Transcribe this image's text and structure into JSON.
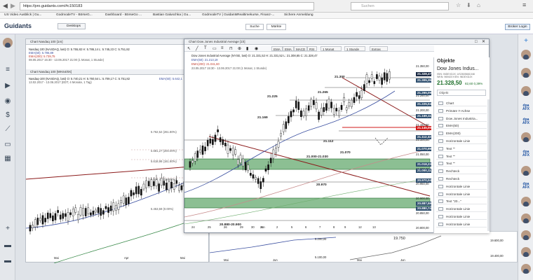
{
  "browser": {
    "url": "https://pro.guidants.com/#c150183",
    "search_placeholder": "Suchen"
  },
  "bookmarks": [
    "US Video Ausblick | Gu...",
    "GodmodeTV - BörseG...",
    "Dashboard - BörseGo ...",
    "Bastian Galuschka | Gu...",
    "GodmodeTV | Guidants",
    "Realtimekurse, Finanz-...",
    "Sichere Anmeldung"
  ],
  "app": {
    "logo": "Guidants",
    "desktop_tab": "Desktops",
    "search_button": "Suche",
    "markets_button": "Märkte",
    "login_button": "Broker Login"
  },
  "nasdaq_chart": {
    "title": "Chart Nasdaq 100 [1m]",
    "legend_top": "Nasdaq 100 (NASDAQ, last)  O: 5.755,82  H: 5.786,14  L: 5.745,23  C: 5.751,82",
    "legend_ema50": "EMA(50): 5.785,89",
    "legend_ema200": "EMA(200): 5.739,75",
    "legend_range": "08.05.2017 15:30 - 13.06.2017 21:00  (1 Monat, 1 Stunde)",
    "sub_title": "Chart Nasdaq 100 [WK64/8X]",
    "sub_legend": "Nasdaq-100 (NASDAQ, last)  O: 5.740,21  H: 5.760,54  L: 5.709,17  C: 5.751,82",
    "sub_ema": "EMA(50): 5.642,1",
    "sub_range": "13.02.2017 - 13.06.2017  (EDT, 4 Monate, 1 Tag)",
    "fib_labels": [
      "5.762,52 (261.80%)",
      "5.681,27 (200.00%)",
      "5.618,98 (161.80%)",
      "5.517,43 (100.00%)",
      "5.453,59 (0.00%)"
    ],
    "months": [
      "Mai",
      "Apr",
      "Mai",
      "Jun"
    ]
  },
  "dow_chart": {
    "title": "Chart Dow Jones Industrial Average [1h]",
    "toolbar": [
      "EMA",
      "EMA",
      "MACD",
      "RSI",
      "1 Monat",
      "1 Stunde",
      "Extras"
    ],
    "legend_top": "Dow Jones Industrial Average (NYSE, last)  O: 21.331,52  H: 21.331,52  L: 21.308,65  C: 21.328,47",
    "legend_ema50": "EMA(50): 21.213,19",
    "legend_ema200": "EMA(200): 21.041,60",
    "legend_range": "23.05.2017 15:30 - 13.06.2017 21:00  (1 Monat, 1 Stunde)",
    "annotations": [
      "21.300",
      "21.265",
      "21.225",
      "21.169",
      "21.112",
      "21.070",
      "21.000-21.030",
      "20.970",
      "20.880-20.900"
    ],
    "price_axis": [
      "21.350,00",
      "21.300,00",
      "21.250,00",
      "21.200,00",
      "21.150,00",
      "21.100,00",
      "21.050,00",
      "21.000,00",
      "20.950,00",
      "20.900,00",
      "20.850,00",
      "20.800,00"
    ],
    "price_tags": [
      {
        "label": "21.328,47",
        "color": "#1b2a44"
      },
      {
        "label": "21.305,35",
        "color": "#2f4f6f"
      },
      {
        "label": "21.265,09",
        "color": "#2f4f6f"
      },
      {
        "label": "21.225,04",
        "color": "#2f4f6f"
      },
      {
        "label": "21.169,11",
        "color": "#2f4f6f"
      },
      {
        "label": "21.145,00",
        "color": "#d01818"
      },
      {
        "label": "21.112,32",
        "color": "#2f4f6f"
      },
      {
        "label": "21.070,99",
        "color": "#2f4f6f"
      },
      {
        "label": "21.018,23",
        "color": "#2f4f6f"
      },
      {
        "label": "21.000,11",
        "color": "#2f4f6f"
      },
      {
        "label": "20.970,04",
        "color": "#2f4f6f"
      },
      {
        "label": "20.887,59",
        "color": "#2f4f6f"
      },
      {
        "label": "20.880,74",
        "color": "#2f4f6f"
      }
    ],
    "x_axis": [
      "24",
      "25",
      "26",
      "29",
      "30",
      "31",
      "Jun",
      "2",
      "5",
      "6",
      "7",
      "8",
      "9",
      "12",
      "13"
    ]
  },
  "bottom_area": {
    "months": [
      "Mai",
      "Jun",
      "Mai",
      "Jun"
    ],
    "values": [
      "5.200,00",
      "5.100,00",
      "19.750",
      "19.600,00",
      "19.400,00"
    ]
  },
  "objects_panel": {
    "header": "Objekte",
    "instrument": "Dow Jones Indus...",
    "isin_line": "ISIN: INDEXDJX: US2605661048",
    "wkn_line": "WKN: 969420  KEN: INDEXDJX",
    "price": "21.328,50",
    "change": "82,60  0,39%",
    "filter_label": "Objekt",
    "items": [
      "Chart",
      "Primäre Y-Achse",
      "Dow Jones Industria...",
      "EMA(50)",
      "EMA(200)",
      "Horizontale Linie",
      "Text \"\"",
      "Text \"\"",
      "Text \"\"",
      "Rechteck",
      "Rechteck",
      "Horizontale Linie",
      "Horizontale Linie",
      "Text \"20...\"",
      "Horizontale Linie",
      "Horizontale Linie",
      "Horizontale Linie"
    ]
  },
  "colors": {
    "up_candle": "#ffffff",
    "down_candle": "#111111",
    "ema50": "#3a4fa0",
    "ema200": "#c0392b",
    "trend_line": "#8b1a1a",
    "zone": "#2e8b3a",
    "accent": "#d01818"
  }
}
